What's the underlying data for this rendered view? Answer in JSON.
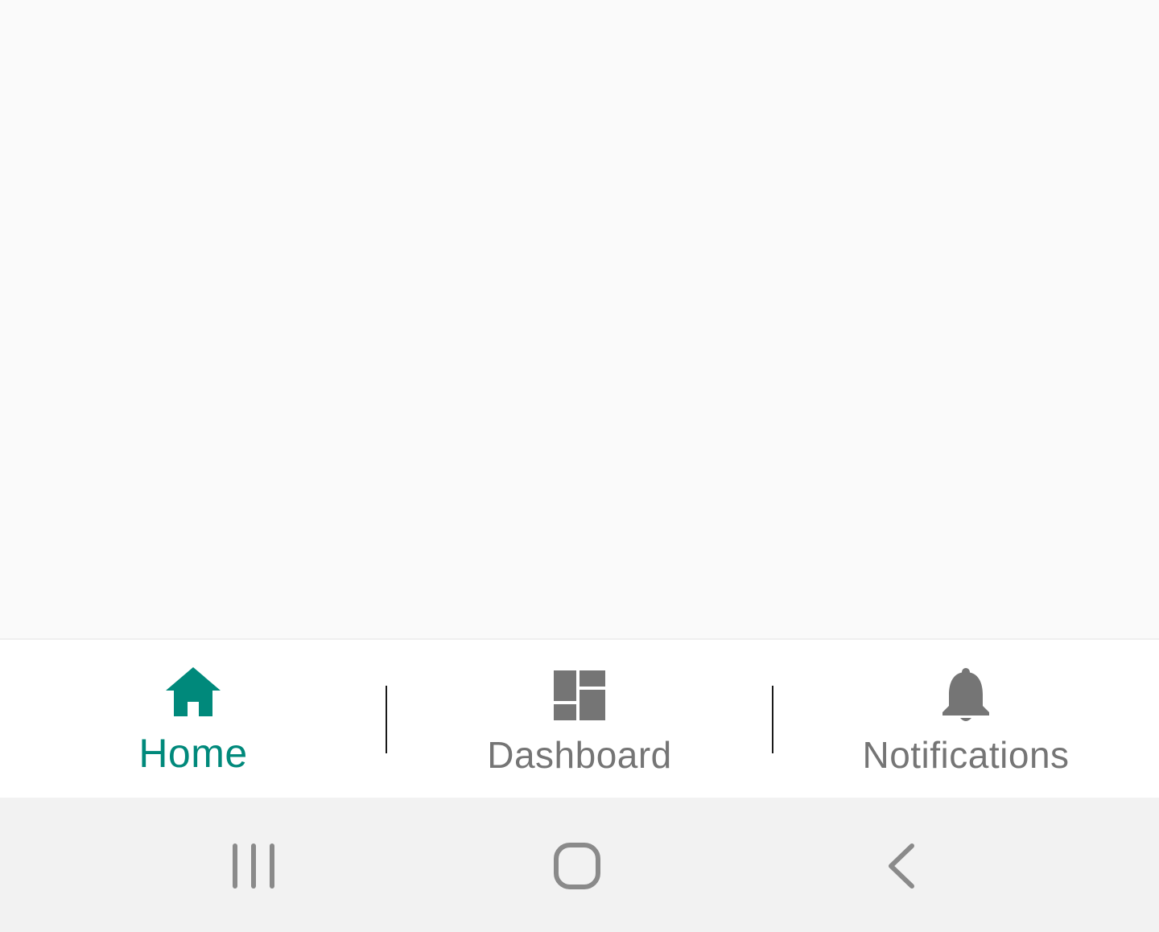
{
  "bottom_nav": {
    "items": [
      {
        "label": "Home",
        "icon": "home-icon",
        "active": true
      },
      {
        "label": "Dashboard",
        "icon": "dashboard-icon",
        "active": false
      },
      {
        "label": "Notifications",
        "icon": "bell-icon",
        "active": false
      }
    ]
  },
  "system_nav": {
    "buttons": [
      {
        "icon": "recent-apps-icon"
      },
      {
        "icon": "home-button-icon"
      },
      {
        "icon": "back-icon"
      }
    ]
  },
  "colors": {
    "accent": "#00897b",
    "inactive": "#757575",
    "content_background": "#fafafa",
    "nav_background": "#ffffff",
    "system_bar_background": "#f2f2f2",
    "system_icon": "#8a8a8a"
  }
}
